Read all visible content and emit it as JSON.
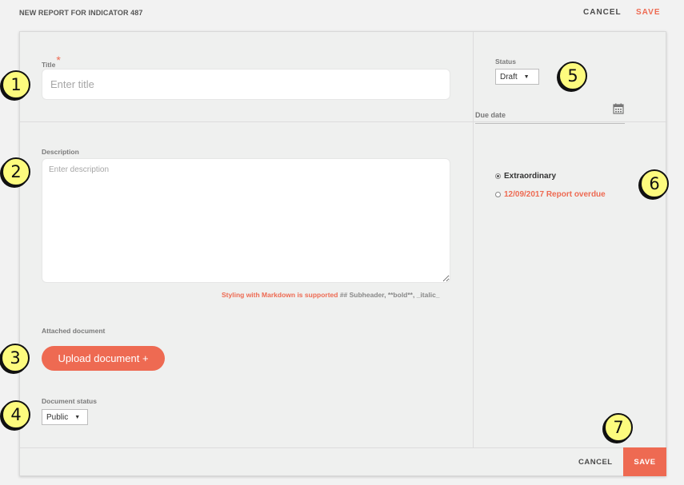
{
  "header": {
    "title": "NEW REPORT FOR INDICATOR 487",
    "cancel_label": "CANCEL",
    "save_label": "SAVE"
  },
  "form": {
    "title_label": "Title",
    "title_required_mark": "*",
    "title_placeholder": "Enter title",
    "description_label": "Description",
    "description_placeholder": "Enter description",
    "markdown_hint_accent": "Styling with Markdown is supported",
    "markdown_hint_rest": " ## Subheader, **bold**, _italic_",
    "attached_document_label": "Attached document",
    "upload_button_label": "Upload document +",
    "document_status_label": "Document status",
    "document_status_value": "Public"
  },
  "side": {
    "status_label": "Status",
    "status_value": "Draft",
    "due_date_label": "Due date",
    "radio_options": [
      {
        "label": "Extraordinary",
        "checked": true,
        "color": "#333333"
      },
      {
        "label": "12/09/2017 Report overdue",
        "checked": false,
        "color": "#ee6a52"
      }
    ]
  },
  "footer": {
    "cancel_label": "CANCEL",
    "save_label": "SAVE"
  },
  "callouts": [
    "1",
    "2",
    "3",
    "4",
    "5",
    "6",
    "7"
  ],
  "colors": {
    "accent": "#ee6a52",
    "callout_fill": "#fdfb7e",
    "background": "#f2f2f2"
  },
  "icons": {
    "caret": "caret-down-icon",
    "calendar": "calendar-icon"
  }
}
